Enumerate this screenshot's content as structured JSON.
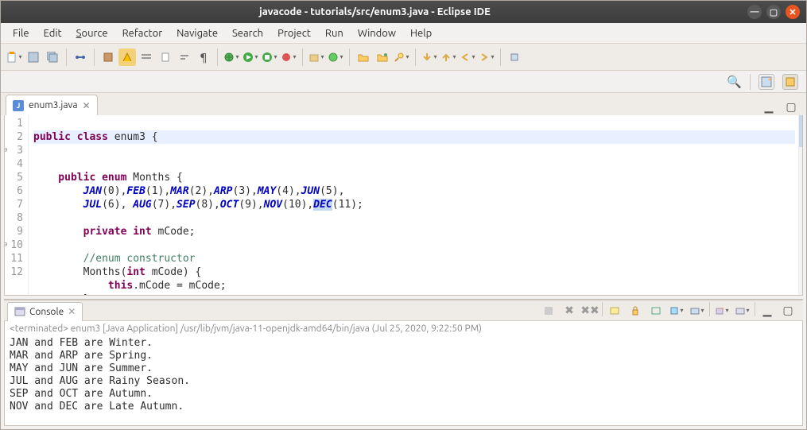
{
  "window": {
    "title": "javacode - tutorials/src/enum3.java - Eclipse IDE"
  },
  "menus": {
    "file": "File",
    "edit": "Edit",
    "source": "Source",
    "refactor": "Refactor",
    "navigate": "Navigate",
    "search": "Search",
    "project": "Project",
    "run": "Run",
    "window": "Window",
    "help": "Help"
  },
  "editor": {
    "tab_label": "enum3.java",
    "code": {
      "l1_a": "public",
      "l1_b": " class",
      "l1_c": " enum3 {",
      "l3_a": "    public",
      "l3_b": " enum",
      "l3_c": " Months {",
      "l4": "        JAN(0),FEB(1),MAR(2),ARP(3),MAY(4),JUN(5),",
      "l5": "        JUL(6), AUG(7),SEP(8),OCT(9),NOV(10),DEC(11);",
      "l7_a": "        private",
      "l7_b": " int",
      "l7_c": " mCode;",
      "l9": "        //enum constructor",
      "l10_a": "        Months(",
      "l10_b": "int",
      "l10_c": " mCode) {",
      "l11_a": "            this",
      "l11_b": ".mCode = mCode;",
      "l12": "        }"
    },
    "gutter": [
      "1",
      "2",
      "3",
      "4",
      "5",
      "6",
      "7",
      "8",
      "9",
      "10",
      "11",
      "12"
    ]
  },
  "console": {
    "tab_label": "Console",
    "runinfo": "<terminated> enum3 [Java Application] /usr/lib/jvm/java-11-openjdk-amd64/bin/java (Jul 25, 2020, 9:22:50 PM)",
    "lines": [
      "JAN and FEB are Winter.",
      "MAR and ARP are Spring.",
      "MAY and JUN are Summer.",
      "JUL and AUG are Rainy Season.",
      "SEP and OCT are Autumn.",
      "NOV and DEC are Late Autumn."
    ]
  }
}
